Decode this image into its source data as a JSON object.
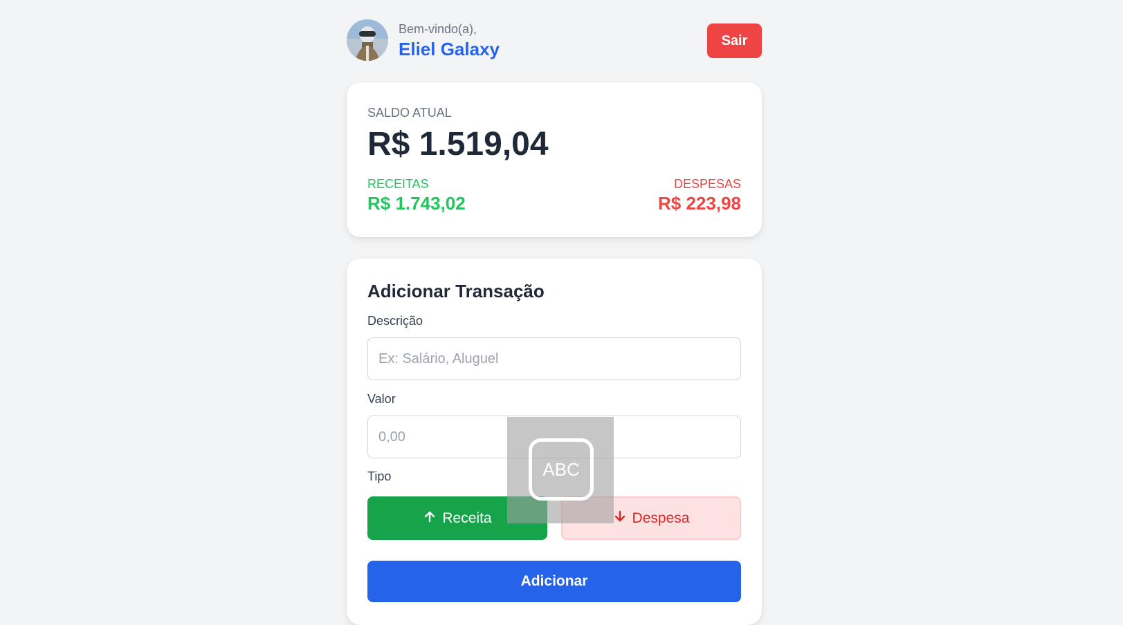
{
  "header": {
    "greeting": "Bem-vindo(a),",
    "user_name": "Eliel Galaxy",
    "logout_label": "Sair"
  },
  "balance": {
    "label": "SALDO ATUAL",
    "value": "R$ 1.519,04",
    "income_label": "RECEITAS",
    "income_value": "R$ 1.743,02",
    "expense_label": "DESPESAS",
    "expense_value": "R$ 223,98"
  },
  "form": {
    "title": "Adicionar Transação",
    "description_label": "Descrição",
    "description_placeholder": "Ex: Salário, Aluguel",
    "amount_label": "Valor",
    "amount_placeholder": "0,00",
    "type_label": "Tipo",
    "income_button": "Receita",
    "expense_button": "Despesa",
    "submit_label": "Adicionar"
  },
  "overlay": {
    "keyboard_indicator": "ABC"
  },
  "colors": {
    "accent": "#2563eb",
    "income": "#22c55e",
    "expense": "#ef4444",
    "logout": "#ef4444"
  }
}
